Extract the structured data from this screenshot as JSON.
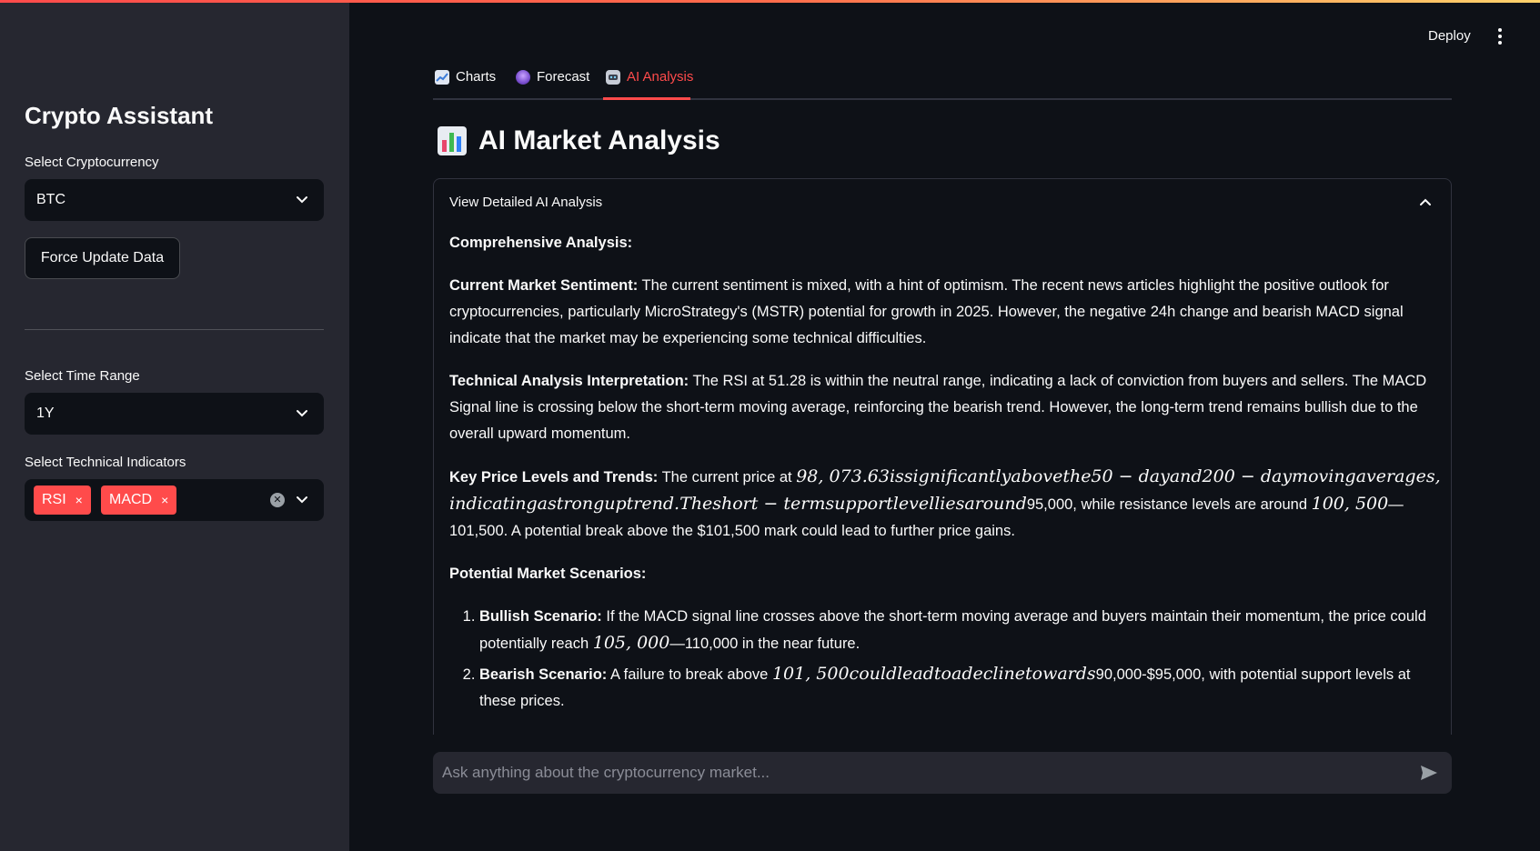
{
  "sidebar": {
    "title": "Crypto Assistant",
    "crypto_label": "Select Cryptocurrency",
    "crypto_value": "BTC",
    "force_update_label": "Force Update Data",
    "time_range_label": "Select Time Range",
    "time_range_value": "1Y",
    "indicators_label": "Select Technical Indicators",
    "indicators": [
      {
        "label": "RSI",
        "remove": "×"
      },
      {
        "label": "MACD",
        "remove": "×"
      }
    ]
  },
  "header": {
    "deploy_label": "Deploy"
  },
  "tabs": [
    {
      "label": "Charts",
      "icon": "chart-icon"
    },
    {
      "label": "Forecast",
      "icon": "crystal-ball-icon"
    },
    {
      "label": "AI Analysis",
      "icon": "robot-icon",
      "active": true
    }
  ],
  "main": {
    "heading": "AI Market Analysis",
    "expander_title": "View Detailed AI Analysis",
    "analysis": {
      "comprehensive": "Comprehensive Analysis:",
      "sentiment_title": "Current Market Sentiment:",
      "sentiment_text": " The current sentiment is mixed, with a hint of optimism. The recent news articles highlight the positive outlook for cryptocurrencies, particularly MicroStrategy's (MSTR) potential for growth in 2025. However, the negative 24h change and bearish MACD signal indicate that the market may be experiencing some technical difficulties.",
      "technical_title": "Technical Analysis Interpretation:",
      "technical_text": " The RSI at 51.28 is within the neutral range, indicating a lack of conviction from buyers and sellers. The MACD Signal line is crossing below the short-term moving average, reinforcing the bearish trend. However, the long-term trend remains bullish due to the overall upward momentum.",
      "levels_title": "Key Price Levels and Trends:",
      "levels_pre": " The current price at ",
      "levels_math1": "98, 073.63issignificantlyabovethe50 − dayand200 − daymovingaverages, indicatingastronguptrend.Theshort − termsupportlevelliesaround",
      "levels_mid": "95,000, while resistance levels are around ",
      "levels_math2": "100, 500",
      "levels_end": "—101,500. A potential break above the $101,500 mark could lead to further price gains.",
      "scenarios_title": "Potential Market Scenarios:",
      "bullish_title": "Bullish Scenario:",
      "bullish_pre": " If the MACD signal line crosses above the short-term moving average and buyers maintain their momentum, the price could potentially reach ",
      "bullish_math": "105, 000",
      "bullish_end": "—110,000 in the near future.",
      "bearish_title": "Bearish Scenario:",
      "bearish_pre": " A failure to break above ",
      "bearish_math": "101, 500couldleadtoadeclinetowards",
      "bearish_end": "90,000-$95,000, with potential support levels at these prices."
    }
  },
  "chat": {
    "placeholder": "Ask anything about the cryptocurrency market..."
  },
  "colors": {
    "accent": "#ff4b4b",
    "sidebar_bg": "#262730",
    "main_bg": "#0e1117"
  }
}
